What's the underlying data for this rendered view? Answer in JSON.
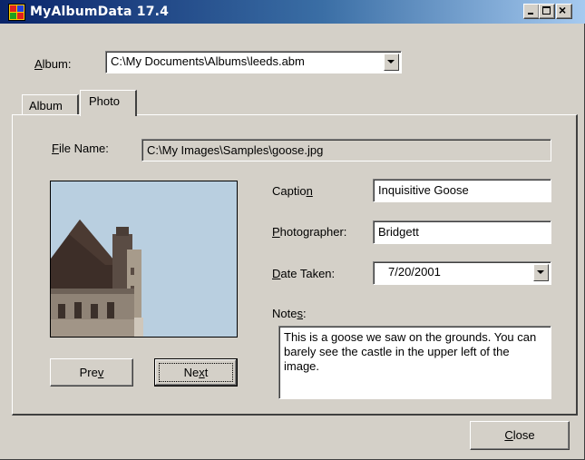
{
  "window": {
    "title": "MyAlbumData 17.4",
    "controls": {
      "minimize": "minimize-icon",
      "maximize": "maximize-icon",
      "close": "close-icon"
    }
  },
  "album": {
    "label_first": "A",
    "label_rest": "lbum:",
    "value": "C:\\My Documents\\Albums\\leeds.abm"
  },
  "tabs": [
    {
      "label": "Album",
      "selected": false
    },
    {
      "label": "Photo",
      "selected": true
    }
  ],
  "photo_tab": {
    "file_name_label_first": "F",
    "file_name_label_rest": "ile Name:",
    "file_name_value": "C:\\My Images\\Samples\\goose.jpg",
    "caption_label_start": "Captio",
    "caption_label_accel": "n",
    "caption_value": "Inquisitive Goose",
    "photographer_label_first": "P",
    "photographer_label_rest": "hotographer:",
    "photographer_value": "Bridgett",
    "date_label_first": "D",
    "date_label_rest": "ate Taken:",
    "date_value": "7/20/2001",
    "notes_label_start": "Note",
    "notes_label_accel": "s",
    "notes_label_end": ":",
    "notes_value": "This is a goose we saw on the grounds. You can barely see the castle in the upper left of the image.",
    "prev_button_start": "Pre",
    "prev_button_accel": "v",
    "next_button_start": "Ne",
    "next_button_accel": "x",
    "next_button_end": "t"
  },
  "footer": {
    "close_button_accel": "C",
    "close_button_rest": "lose"
  },
  "colors": {
    "face": "#d4d0c8",
    "title_start": "#0a246a",
    "title_end": "#a6caf0"
  }
}
